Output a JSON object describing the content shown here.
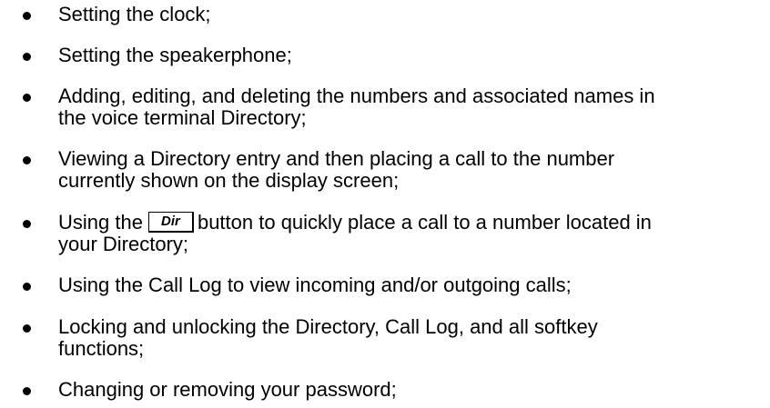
{
  "items": [
    {
      "lines": [
        "Setting the clock;"
      ]
    },
    {
      "lines": [
        "Setting the speakerphone;"
      ]
    },
    {
      "lines": [
        "Adding, editing, and deleting the numbers and associated names in",
        "the voice terminal Directory;"
      ]
    },
    {
      "lines": [
        "Viewing a Directory entry and then placing a call to the number",
        "currently shown on the display screen;"
      ]
    },
    {
      "pre": "Using the",
      "key": "Dir",
      "post": "button to quickly place a call to a number located in",
      "line2": "your Directory;"
    },
    {
      "lines": [
        "Using the Call Log to view incoming and/or outgoing calls;"
      ]
    },
    {
      "lines": [
        "Locking and unlocking the Directory, Call Log, and all softkey",
        "functions;"
      ]
    },
    {
      "lines": [
        "Changing or removing your password;"
      ]
    }
  ]
}
